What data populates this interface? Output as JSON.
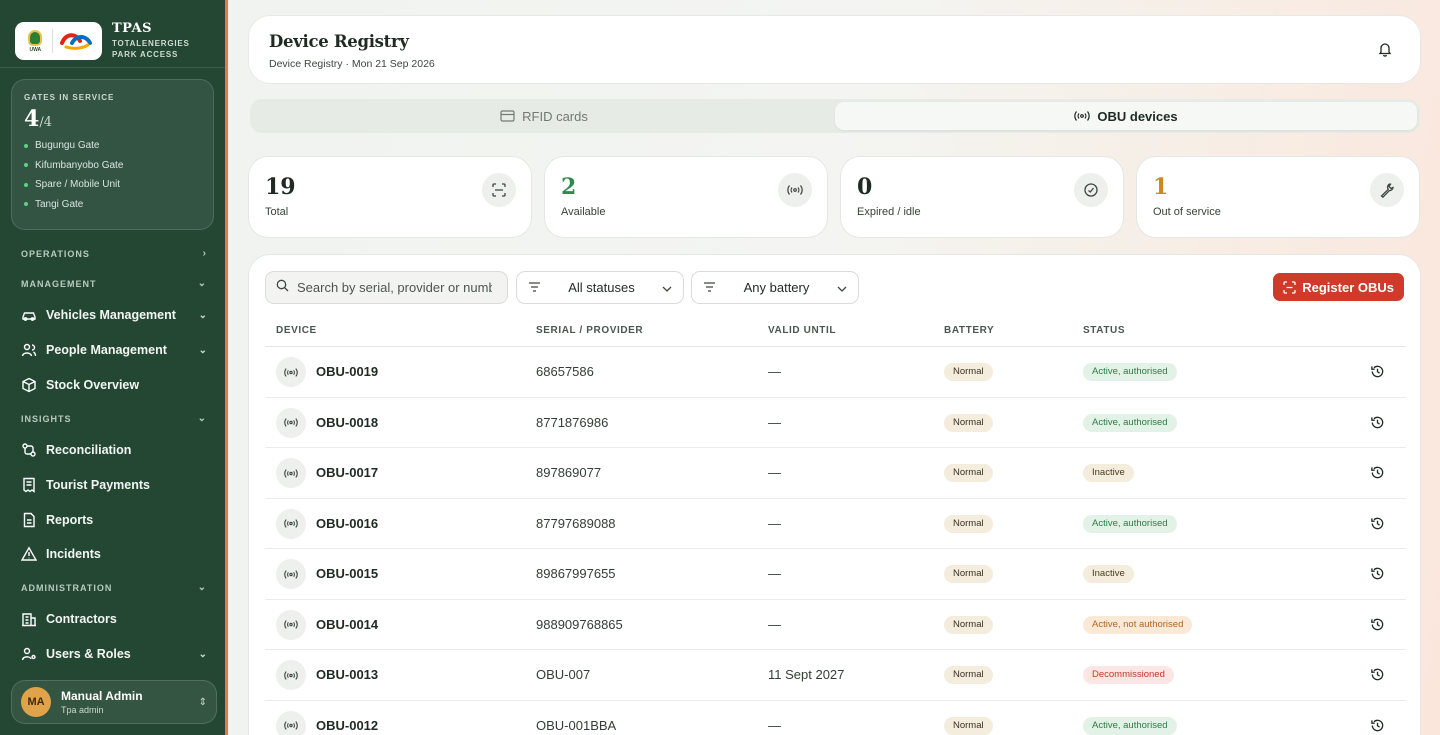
{
  "brand": {
    "logo_left": "UWA",
    "title": "TPAS",
    "subtitle_1": "TOTALENERGIES",
    "subtitle_2": "PARK ACCESS"
  },
  "gates": {
    "label": "GATES IN SERVICE",
    "in_service": "4",
    "total": "/4",
    "list": [
      "Bugungu Gate",
      "Kifumbanyobo Gate",
      "Spare / Mobile Unit",
      "Tangi Gate"
    ]
  },
  "nav": {
    "operations": "OPERATIONS",
    "management": "MANAGEMENT",
    "vehicles": "Vehicles Management",
    "people": "People Management",
    "stock": "Stock Overview",
    "insights": "INSIGHTS",
    "reconciliation": "Reconciliation",
    "tourist_payments": "Tourist Payments",
    "reports": "Reports",
    "incidents": "Incidents",
    "administration": "ADMINISTRATION",
    "contractors": "Contractors",
    "users_roles": "Users & Roles"
  },
  "user": {
    "initials": "MA",
    "name": "Manual Admin",
    "role": "Tpa admin"
  },
  "header": {
    "title": "Device Registry",
    "breadcrumb": "Device Registry · Mon 21 Sep 2026"
  },
  "tabs": {
    "rfid": "RFID cards",
    "obu": "OBU devices",
    "active": "obu"
  },
  "stats": [
    {
      "value": "19",
      "label": "Total",
      "color": "#1f2a24",
      "icon": "scan-icon"
    },
    {
      "value": "2",
      "label": "Available",
      "color": "#2f8a4d",
      "icon": "signal-icon"
    },
    {
      "value": "0",
      "label": "Expired / idle",
      "color": "#1f2a24",
      "icon": "check-circle-icon"
    },
    {
      "value": "1",
      "label": "Out of service",
      "color": "#c98a1f",
      "icon": "wrench-icon"
    }
  ],
  "toolbar": {
    "search_placeholder": "Search by serial, provider or number",
    "status_filter": "All statuses",
    "battery_filter": "Any battery",
    "register_label": "Register OBUs"
  },
  "columns": {
    "device": "DEVICE",
    "serial": "SERIAL / PROVIDER",
    "valid": "VALID UNTIL",
    "battery": "BATTERY",
    "status": "STATUS"
  },
  "rows": [
    {
      "device": "OBU-0019",
      "serial": "68657586",
      "valid": "—",
      "battery": "Normal",
      "status": "Active, authorised",
      "status_kind": "active"
    },
    {
      "device": "OBU-0018",
      "serial": "8771876986",
      "valid": "—",
      "battery": "Normal",
      "status": "Active, authorised",
      "status_kind": "active"
    },
    {
      "device": "OBU-0017",
      "serial": "897869077",
      "valid": "—",
      "battery": "Normal",
      "status": "Inactive",
      "status_kind": "inactive"
    },
    {
      "device": "OBU-0016",
      "serial": "87797689088",
      "valid": "—",
      "battery": "Normal",
      "status": "Active, authorised",
      "status_kind": "active"
    },
    {
      "device": "OBU-0015",
      "serial": "89867997655",
      "valid": "—",
      "battery": "Normal",
      "status": "Inactive",
      "status_kind": "inactive"
    },
    {
      "device": "OBU-0014",
      "serial": "988909768865",
      "valid": "—",
      "battery": "Normal",
      "status": "Active, not authorised",
      "status_kind": "notauth"
    },
    {
      "device": "OBU-0013",
      "serial": "OBU-007",
      "valid": "11 Sept 2027",
      "battery": "Normal",
      "status": "Decommissioned",
      "status_kind": "decom"
    },
    {
      "device": "OBU-0012",
      "serial": "OBU-001BBA",
      "valid": "—",
      "battery": "Normal",
      "status": "Active, authorised",
      "status_kind": "active"
    }
  ]
}
